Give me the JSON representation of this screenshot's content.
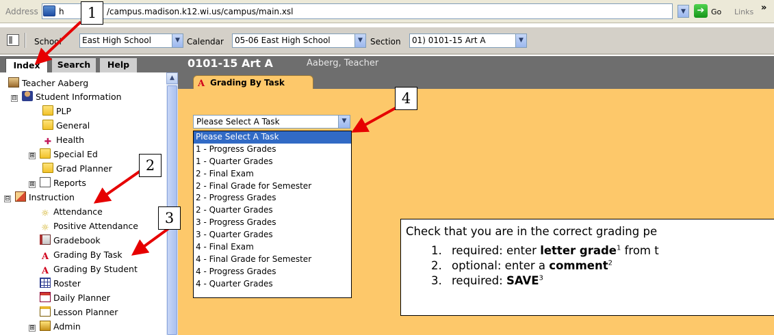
{
  "address_bar": {
    "label": "Address",
    "url_prefix": "h",
    "url": "/campus.madison.k12.wi.us/campus/main.xsl",
    "go_label": "Go",
    "links_label": "Links",
    "links_chevron": "»",
    "ie_icon": "ie-page-icon",
    "go_icon": "go-arrow-icon"
  },
  "toolbar": {
    "school_label": "School",
    "school_value": "East High School",
    "calendar_label": "Calendar",
    "calendar_value": "05-06 East High School",
    "section_label": "Section",
    "section_value": "01) 0101-15 Art A",
    "icon": "frame-toggle-icon"
  },
  "left_tabs": {
    "index": "Index",
    "search": "Search",
    "help": "Help"
  },
  "tree": {
    "root": "Teacher Aaberg",
    "student_information": "Student Information",
    "plp": "PLP",
    "general": "General",
    "health": "Health",
    "special_ed": "Special Ed",
    "grad_planner": "Grad Planner",
    "reports": "Reports",
    "instruction": "Instruction",
    "attendance": "Attendance",
    "positive_attendance": "Positive Attendance",
    "gradebook": "Gradebook",
    "grading_by_task": "Grading By Task",
    "grading_by_student": "Grading By Student",
    "roster": "Roster",
    "daily_planner": "Daily Planner",
    "lesson_planner": "Lesson Planner",
    "admin": "Admin",
    "toggle_plus": "⊞",
    "toggle_minus": "⊟"
  },
  "main": {
    "title": "0101-15 Art A",
    "subtitle": "Aaberg, Teacher",
    "tab_label": "Grading By Task",
    "task_select_value": "Please Select A Task",
    "task_options": [
      "Please Select A Task",
      "1 - Progress Grades",
      "1 - Quarter Grades",
      "2 - Final Exam",
      "2 - Final Grade for Semester",
      "2 - Progress Grades",
      "2 - Quarter Grades",
      "3 - Progress Grades",
      "3 - Quarter Grades",
      "4 - Final Exam",
      "4 - Final Grade for Semester",
      "4 - Progress Grades",
      "4 - Quarter Grades"
    ]
  },
  "note": {
    "heading": "Check that you are in the correct grading pe",
    "items": [
      {
        "num": "1.",
        "pre": "required: enter ",
        "bold": "letter grade",
        "sup": "1",
        "post": " from t"
      },
      {
        "num": "2.",
        "pre": "optional: enter a ",
        "bold": "comment",
        "sup": "2",
        "post": ""
      },
      {
        "num": "3.",
        "pre": "required: ",
        "bold": "SAVE",
        "sup": "3",
        "post": ""
      }
    ]
  },
  "callouts": [
    "1",
    "2",
    "3",
    "4"
  ],
  "colors": {
    "content_bg": "#fdc86a",
    "header_bg": "#6e6e6e",
    "arrow_red": "#e60000",
    "selection_blue": "#316ac5"
  }
}
